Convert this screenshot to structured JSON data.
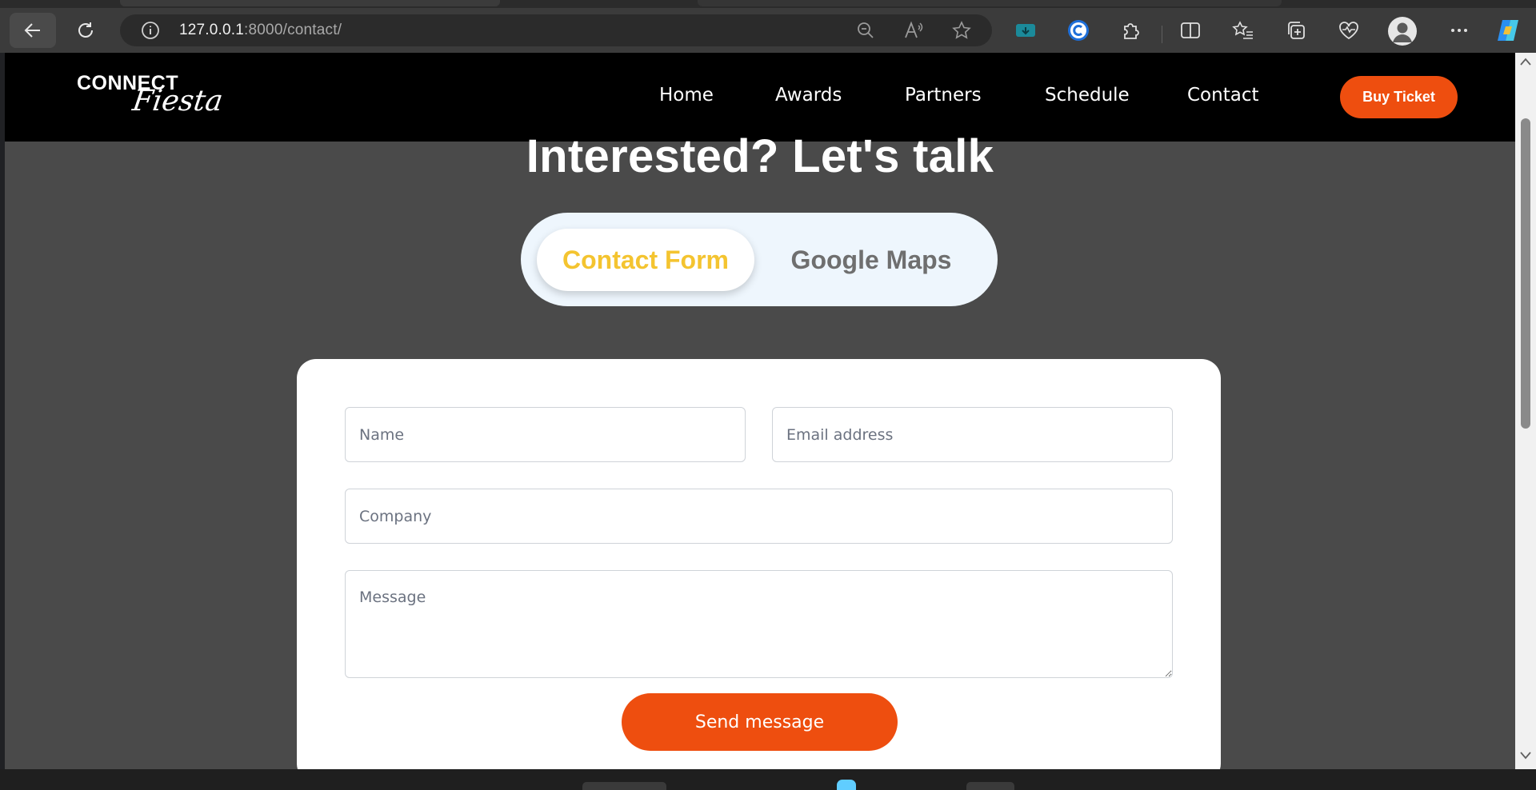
{
  "browser": {
    "url_host": "127.0.0.1",
    "url_path": ":8000/contact/",
    "icons": [
      "back-arrow-icon",
      "reload-icon",
      "site-info-icon",
      "zoom-out-icon",
      "read-aloud-icon",
      "favorite-star-icon",
      "tab-action-icon",
      "c-extension-icon",
      "extensions-puzzle-icon",
      "split-screen-icon",
      "favorites-list-icon",
      "collections-icon",
      "browser-essentials-icon",
      "profile-avatar-icon",
      "more-menu-icon",
      "copilot-icon"
    ]
  },
  "site": {
    "logo": {
      "connect": "CONNECT",
      "fiesta": "Fiesta"
    },
    "nav": [
      "Home",
      "Awards",
      "Partners",
      "Schedule",
      "Contact"
    ],
    "buy_ticket": "Buy Ticket"
  },
  "hero": {
    "title": "Interested? Let's talk"
  },
  "toggle": {
    "active": "Contact Form",
    "inactive": "Google Maps"
  },
  "form": {
    "name_placeholder": "Name",
    "email_placeholder": "Email address",
    "company_placeholder": "Company",
    "message_placeholder": "Message",
    "submit": "Send message"
  },
  "colors": {
    "accent": "#ee4e0f",
    "toggle_active_text": "#f4c430",
    "toggle_inactive_text": "#6f6f6f",
    "header_bg": "#000000",
    "page_bg": "#4a4a4a"
  }
}
